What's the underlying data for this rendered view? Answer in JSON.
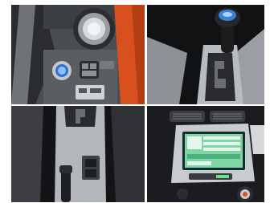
{
  "collage": {
    "panels": [
      {
        "label": "dashboard-left-vent-and-switches"
      },
      {
        "label": "shift-lever-top"
      },
      {
        "label": "center-console-switch-panel"
      },
      {
        "label": "center-stack-navigation-screen"
      }
    ]
  },
  "colors": {
    "background": "#ffffff",
    "trim_orange": "#d8501e",
    "dash_dark": "#1c1c1e",
    "console_gray": "#b9bcbf",
    "screen_green": "#7fd6a3",
    "start_button_blue": "#2f6fd0"
  },
  "icons": [
    "air-vent-icon",
    "start-button-icon",
    "shift-knob-icon",
    "nav-screen-icon"
  ]
}
